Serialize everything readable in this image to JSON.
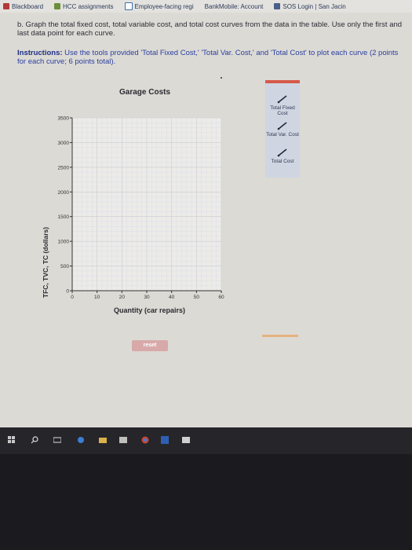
{
  "bookmarks": [
    {
      "label": "Blackboard",
      "color": "#b23a3a"
    },
    {
      "label": "HCC assignments",
      "color": "#6b8f3a"
    },
    {
      "label": "Employee-facing regi",
      "color": "#3a6fb2"
    },
    {
      "label": "BankMobile: Account",
      "color": "#2a3a5c"
    },
    {
      "label": "SOS Login | San Jacin",
      "color": "#4a5f8c"
    }
  ],
  "question": {
    "text": "b. Graph the total fixed cost, total variable cost, and total cost curves from the data in the table. Use only the first and last data point for each curve."
  },
  "instructions": {
    "label": "Instructions:",
    "text": " Use the tools provided 'Total Fixed Cost,' 'Total Var. Cost,' and 'Total Cost' to plot each curve (2 points for each curve; 6 points total)."
  },
  "chart_data": {
    "type": "line",
    "title": "Garage Costs",
    "xlabel": "Quantity (car repairs)",
    "ylabel": "TFC, TVC, TC (dollars)",
    "x_ticks": [
      0,
      10,
      20,
      30,
      40,
      50,
      60
    ],
    "y_ticks": [
      0,
      500,
      1000,
      1500,
      2000,
      2500,
      3000,
      3500
    ],
    "xlim": [
      0,
      60
    ],
    "ylim": [
      0,
      3500
    ],
    "grid": true,
    "series": []
  },
  "tools": [
    {
      "label": "Total Fixed Cost",
      "icon": "line-tool-icon"
    },
    {
      "label": "Total Var. Cost",
      "icon": "line-tool-icon"
    },
    {
      "label": "Total Cost",
      "icon": "line-tool-icon"
    }
  ],
  "reset_label": "reset",
  "colors": {
    "palette_bg": "#cfd6e2",
    "reset_bg": "#d8a9a9",
    "accent": "#2a3fa0"
  }
}
